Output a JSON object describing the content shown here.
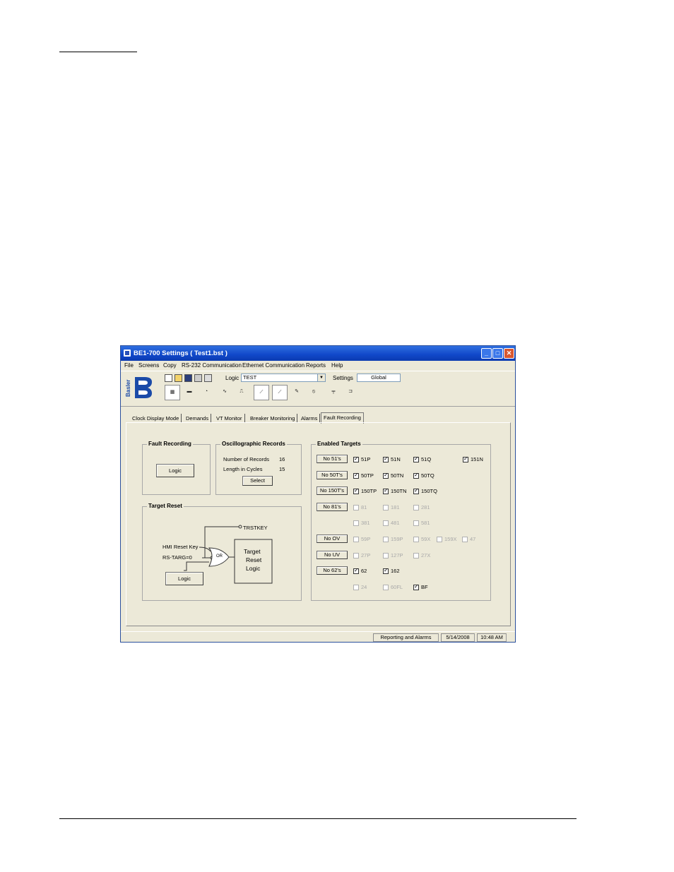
{
  "window": {
    "title": "BE1-700 Settings   ( Test1.bst )"
  },
  "menu": [
    "File",
    "Screens",
    "Copy",
    "RS-232 Communication",
    "Ethernet Communication",
    "Reports",
    "Help"
  ],
  "toolbar": {
    "logic_label": "Logic",
    "logic_value": "TEST",
    "settings_label": "Settings",
    "settings_value": "Global",
    "brand_text": "Basler"
  },
  "tabs": [
    "Clock Display Mode",
    "Demands",
    "VT Monitor",
    "Breaker Monitoring",
    "Alarms",
    "Fault Recording"
  ],
  "fault_recording": {
    "title": "Fault Recording",
    "logic_button": "Logic"
  },
  "oscillographic": {
    "title": "Oscillographic Records",
    "records_label": "Number of Records",
    "records_value": "16",
    "cycles_label": "Length in Cycles",
    "cycles_value": "15",
    "select_button": "Select"
  },
  "target_reset": {
    "title": "Target Reset",
    "trstkey": "TRSTKEY",
    "hmi_reset_key": "HMI Reset Key",
    "rs_targ": "RS-TARG=0",
    "or_label": "OR",
    "logic_box_l1": "Target",
    "logic_box_l2": "Reset",
    "logic_box_l3": "Logic",
    "logic_button": "Logic"
  },
  "enabled_targets": {
    "title": "Enabled Targets",
    "buttons": [
      "No 51's",
      "No 50T's",
      "No 150T's",
      "No 81's",
      "No OV",
      "No UV",
      "No 62's"
    ],
    "items": [
      {
        "label": "51P",
        "checked": true,
        "enabled": true
      },
      {
        "label": "51N",
        "checked": true,
        "enabled": true
      },
      {
        "label": "51Q",
        "checked": true,
        "enabled": true
      },
      {
        "label": "151N",
        "checked": true,
        "enabled": true
      },
      {
        "label": "50TP",
        "checked": true,
        "enabled": true
      },
      {
        "label": "50TN",
        "checked": true,
        "enabled": true
      },
      {
        "label": "50TQ",
        "checked": true,
        "enabled": true
      },
      {
        "label": "150TP",
        "checked": true,
        "enabled": true
      },
      {
        "label": "150TN",
        "checked": true,
        "enabled": true
      },
      {
        "label": "150TQ",
        "checked": true,
        "enabled": true
      },
      {
        "label": "81",
        "checked": false,
        "enabled": false
      },
      {
        "label": "181",
        "checked": false,
        "enabled": false
      },
      {
        "label": "281",
        "checked": false,
        "enabled": false
      },
      {
        "label": "381",
        "checked": false,
        "enabled": false
      },
      {
        "label": "481",
        "checked": false,
        "enabled": false
      },
      {
        "label": "581",
        "checked": false,
        "enabled": false
      },
      {
        "label": "59P",
        "checked": false,
        "enabled": false
      },
      {
        "label": "159P",
        "checked": false,
        "enabled": false
      },
      {
        "label": "59X",
        "checked": false,
        "enabled": false
      },
      {
        "label": "159X",
        "checked": false,
        "enabled": false
      },
      {
        "label": "47",
        "checked": false,
        "enabled": false
      },
      {
        "label": "27P",
        "checked": false,
        "enabled": false
      },
      {
        "label": "127P",
        "checked": false,
        "enabled": false
      },
      {
        "label": "27X",
        "checked": false,
        "enabled": false
      },
      {
        "label": "62",
        "checked": true,
        "enabled": true
      },
      {
        "label": "162",
        "checked": true,
        "enabled": true
      },
      {
        "label": "24",
        "checked": false,
        "enabled": false
      },
      {
        "label": "60FL",
        "checked": false,
        "enabled": false
      },
      {
        "label": "BF",
        "checked": true,
        "enabled": true
      }
    ]
  },
  "status": {
    "mode": "Reporting and Alarms",
    "date": "5/14/2008",
    "time": "10:48 AM"
  }
}
